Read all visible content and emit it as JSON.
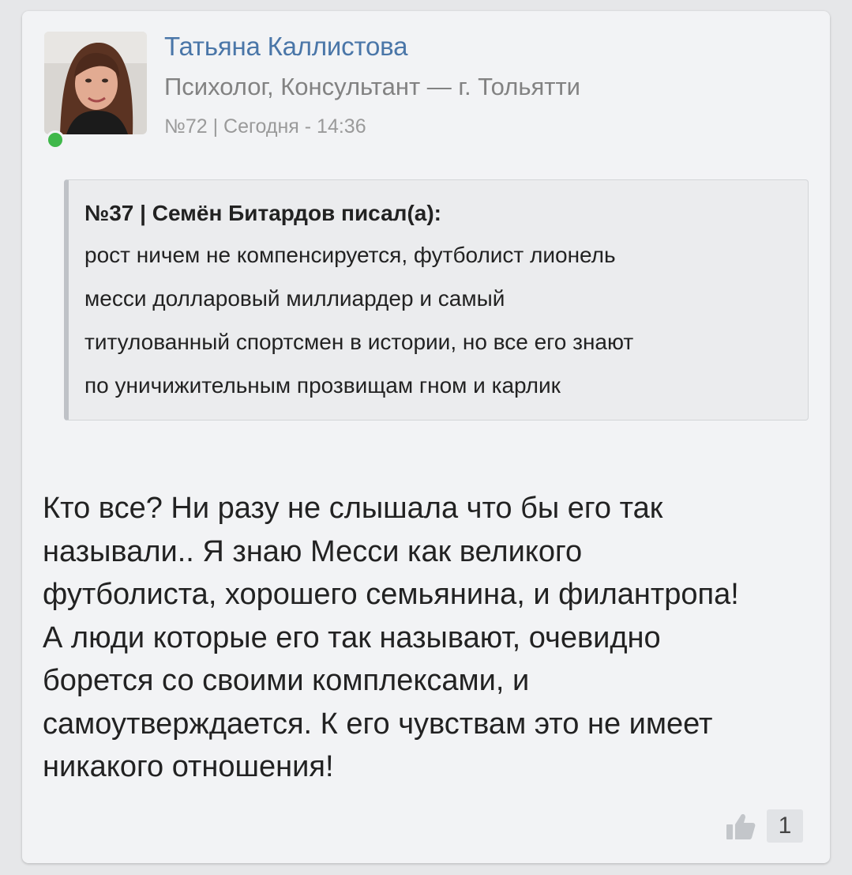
{
  "post": {
    "author": {
      "name": "Татьяна Каллистова",
      "role": "Психолог, Консультант — г. Тольятти",
      "online": true
    },
    "meta": "№72 | Сегодня - 14:36",
    "quote": {
      "header": "№37 | Семён Битардов писал(а):",
      "lines": [
        "рост ничем не компенсируется, футболист лионель",
        "месси долларовый миллиардер и самый",
        "титулованный спортсмен в истории, но все его знают",
        "по уничижительным прозвищам гном и карлик"
      ]
    },
    "text_lines": [
      "Кто все? Ни разу не слышала что бы его так",
      "называли.. Я знаю Месси как великого",
      "футболиста, хорошего семьянина, и филантропа!",
      "А люди которые его так называют, очевидно",
      "борется со своими комплексами, и",
      "самоутверждается. К его чувствам это не имеет",
      "никакого отношения!"
    ],
    "likes": {
      "icon": "thumbs-up-icon",
      "count": "1"
    }
  },
  "colors": {
    "author_link": "#4a76a8",
    "online": "#3fb84a",
    "card_bg": "#f2f3f5"
  }
}
